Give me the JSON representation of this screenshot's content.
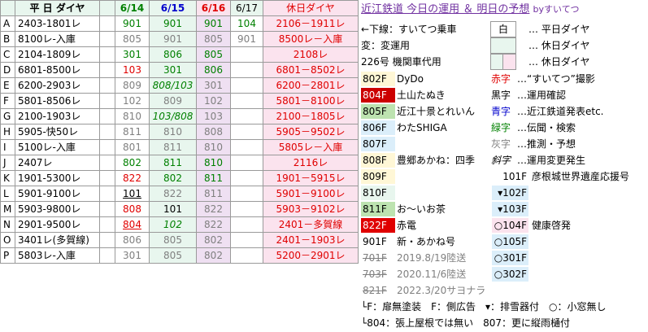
{
  "header": {
    "key_col": "",
    "weekday_label": "平 日 ダイヤ",
    "d614": "6/14",
    "d615": "6/15",
    "d616": "6/16",
    "d617": "6/17",
    "holiday_label": "休日ダイヤ"
  },
  "title": {
    "main": "近江鉄道 今日の運用 ＆ 明日の予想",
    "by": "byすいてつ"
  },
  "rows": [
    {
      "key": "A",
      "weekday": "2403-1801レ",
      "d614": "901",
      "d615": "901",
      "d616": "901",
      "d617": "104",
      "holiday": "2106－1911レ"
    },
    {
      "key": "B",
      "weekday": "8100レ-入庫",
      "d614": "805",
      "d615": "901",
      "d616": "805",
      "d617": "901",
      "holiday": "8500レ－入庫"
    },
    {
      "key": "C",
      "weekday": "2104-1809レ",
      "d614": "301",
      "d615": "806",
      "d616": "805",
      "d617": "",
      "holiday": "2108レ"
    },
    {
      "key": "D",
      "weekday": "6801-8500レ",
      "d614": "103",
      "d615": "301",
      "d616": "806",
      "d617": "",
      "holiday": "6801－8502レ"
    },
    {
      "key": "E",
      "weekday": "6200-2903レ",
      "d614": "809",
      "d615": "808/103",
      "d616": "301",
      "d617": "",
      "holiday": "6200－2801レ"
    },
    {
      "key": "F",
      "weekday": "5801-8506レ",
      "d614": "102",
      "d615": "809",
      "d616": "102",
      "d617": "",
      "holiday": "5801－8100レ"
    },
    {
      "key": "G",
      "weekday": "2100-1903レ",
      "d614": "810",
      "d615": "103/808",
      "d616": "103",
      "d617": "",
      "holiday": "2100－1805レ"
    },
    {
      "key": "H",
      "weekday": "5905-快50レ",
      "d614": "811",
      "d615": "810",
      "d616": "808",
      "d617": "",
      "holiday": "5905－9502レ"
    },
    {
      "key": "I",
      "weekday": "5100レ-入庫",
      "d614": "801",
      "d615": "811",
      "d616": "810",
      "d617": "",
      "holiday": "5805レ－入庫"
    },
    {
      "key": "J",
      "weekday": "2407レ",
      "d614": "802",
      "d615": "811",
      "d616": "810",
      "d617": "",
      "holiday": "2116レ"
    },
    {
      "key": "K",
      "weekday": "1901-5300レ",
      "d614": "822",
      "d615": "802",
      "d616": "811",
      "d617": "",
      "holiday": "1901－5915レ"
    },
    {
      "key": "L",
      "weekday": "5901-9100レ",
      "d614": "101",
      "d615": "822",
      "d616": "811",
      "d617": "",
      "holiday": "5901－9100レ"
    },
    {
      "key": "M",
      "weekday": "5903-9800レ",
      "d614": "808",
      "d615": "101",
      "d616": "822",
      "d617": "",
      "holiday": "5903－9102レ"
    },
    {
      "key": "N",
      "weekday": "2901-9500レ",
      "d614": "804",
      "d615": "102",
      "d616": "822",
      "d617": "",
      "holiday": "2401－多賀線"
    },
    {
      "key": "O",
      "weekday": "3401レ(多賀線)",
      "d614": "806",
      "d615": "805",
      "d616": "802",
      "d617": "",
      "holiday": "2401－1903レ"
    },
    {
      "key": "P",
      "weekday": "5803レ-入庫",
      "d614": "301",
      "d615": "805",
      "d616": "802",
      "d617": "",
      "holiday": "5200－2901レ"
    }
  ],
  "legend": {
    "l1": "←下線：すいてつ乗車",
    "l2": "変：変運用",
    "l3": "226号 機関車代用",
    "shiro": "白",
    "weekday_mark": "… 平日ダイヤ",
    "holiday_mark1": "… 休日ダイヤ",
    "holiday_mark2": "… 休日ダイヤ"
  },
  "units": [
    {
      "num": "802F",
      "desc": "DyDo"
    },
    {
      "num": "804F",
      "desc": "土山たぬき"
    },
    {
      "num": "805F",
      "desc": "近江十景とれいん"
    },
    {
      "num": "806F",
      "desc": "わたSHIGA"
    },
    {
      "num": "807F",
      "desc": ""
    },
    {
      "num": "808F",
      "desc": "豊郷あかね：四季"
    },
    {
      "num": "809F",
      "desc": ""
    },
    {
      "num": "810F",
      "desc": ""
    },
    {
      "num": "811F",
      "desc": "お～いお茶"
    },
    {
      "num": "822F",
      "desc": "赤電"
    },
    {
      "num": "901F",
      "desc": "新・あかね号"
    },
    {
      "num": "701F",
      "desc": "2019.8/19陸送"
    },
    {
      "num": "703F",
      "desc": "2020.11/6陸送"
    },
    {
      "num": "821F",
      "desc": "2022.3/20サヨナラ"
    }
  ],
  "colors_legend": [
    {
      "label": "赤字",
      "desc": "…“すいてつ”撮影"
    },
    {
      "label": "黒字",
      "desc": "…運用確認"
    },
    {
      "label": "青字",
      "desc": "…近江鉄道発表etc."
    },
    {
      "label": "緑字",
      "desc": "…伝聞・検索"
    },
    {
      "label": "灰字",
      "desc": "…推測・予想"
    },
    {
      "label": "斜字",
      "desc": "…運用変更発生"
    }
  ],
  "small_units": [
    {
      "num": "101F",
      "desc": "彦根城世界遺産応援号"
    },
    {
      "num": "▾102F",
      "desc": ""
    },
    {
      "num": "▾103F",
      "desc": ""
    },
    {
      "num": "○104F",
      "desc": "健康啓発"
    },
    {
      "num": "○105F",
      "desc": ""
    },
    {
      "num": "○301F",
      "desc": ""
    },
    {
      "num": "○302F",
      "desc": ""
    }
  ],
  "notes": {
    "n1": "└F：扉無塗装　F：側広告　▾：排雪器付　○：小窓無し",
    "n2": "└804：張上屋根では無い　807：更に縦雨樋付"
  },
  "accent": {
    "purple": "#7030a0",
    "red": "#e00000",
    "green": "#008000",
    "blue": "#0000cc"
  }
}
